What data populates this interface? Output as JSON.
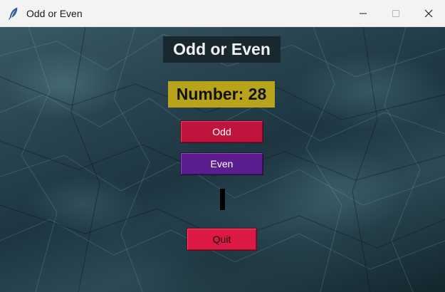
{
  "window": {
    "title": "Odd or Even",
    "app_icon": "feather-icon",
    "controls": [
      "minimize-icon",
      "maximize-icon",
      "close-icon"
    ]
  },
  "game": {
    "title": "Odd or Even",
    "number_text": "Number: 28",
    "odd_label": "Odd",
    "even_label": "Even",
    "result_text": "",
    "quit_label": "Quit"
  },
  "colors": {
    "title_bg": "#18282e",
    "number_bg": "#b8a41a",
    "odd_bg": "#c0143e",
    "even_bg": "#5b1d8f",
    "result_bg": "#000000",
    "quit_bg": "#dc1845"
  }
}
